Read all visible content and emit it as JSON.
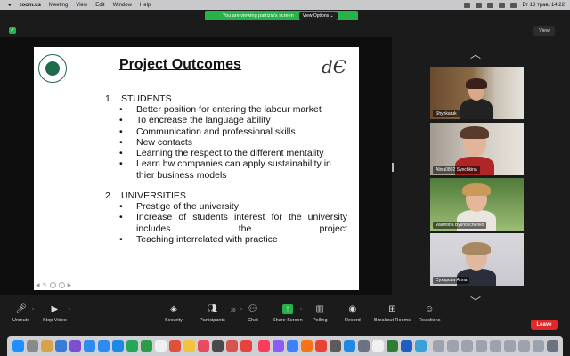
{
  "menubar": {
    "app": "zoom.us",
    "items": [
      "Meeting",
      "View",
      "Edit",
      "Window",
      "Help"
    ],
    "clock": "Вт 18 трав.  14:22"
  },
  "banner": {
    "text": "You are viewing patrizia's screen",
    "options": "View Options ⌄"
  },
  "view_button": "View",
  "slide": {
    "title": "Project Outcomes",
    "logo_text": "dЄ",
    "section1_num": "1.",
    "section1": "STUDENTS",
    "students": [
      "Better position for entering the labour market",
      "To encrease the language ability",
      "Communication and professional skills",
      "New contacts",
      "Learning the respect to the different mentality",
      "Learn hw companies can apply sustainability in thier business models"
    ],
    "section2_num": "2.",
    "section2": "UNIVERSITIES",
    "universities": [
      "Prestige of the university",
      "Increase of students interest for the university includes the project",
      "Teaching interrelated with practice"
    ]
  },
  "participants": [
    {
      "name": "Shynkaruk"
    },
    {
      "name": "Alina0802 Syechkina"
    },
    {
      "name": "Valentina Bykhovchenko"
    },
    {
      "name": "Сухарєва Алла"
    }
  ],
  "toolbar": {
    "unmute": "Unmute",
    "stop_video": "Stop Video",
    "security": "Security",
    "participants": "Participants",
    "participants_count": "39",
    "chat": "Chat",
    "share_screen": "Share Screen",
    "polling": "Polling",
    "record": "Record",
    "breakout": "Breakout Rooms",
    "reactions": "Reactions",
    "leave": "Leave"
  },
  "colors": {
    "accent_green": "#27b34a",
    "leave_red": "#e02828"
  }
}
